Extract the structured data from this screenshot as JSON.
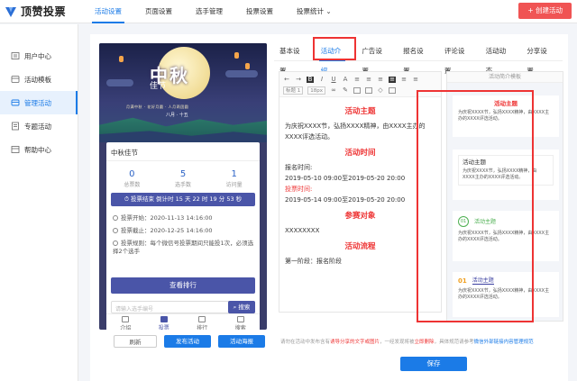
{
  "brand": {
    "name": "顶赞投票",
    "color": "#1b7be7",
    "logo_color": "#2b6fd6"
  },
  "topnav": [
    {
      "label": "活动设置",
      "active": true
    },
    {
      "label": "页面设置",
      "active": false
    },
    {
      "label": "选手管理",
      "active": false
    },
    {
      "label": "投票设置",
      "active": false
    },
    {
      "label": "投票统计",
      "active": false
    }
  ],
  "create_button": "+ 创建活动",
  "sidebar": [
    {
      "label": "用户中心",
      "icon": "user-icon",
      "active": false
    },
    {
      "label": "活动模板",
      "icon": "template-icon",
      "active": false
    },
    {
      "label": "管理活动",
      "icon": "manage-icon",
      "active": true
    },
    {
      "label": "专题活动",
      "icon": "topic-icon",
      "active": false
    },
    {
      "label": "帮助中心",
      "icon": "help-icon",
      "active": false
    }
  ],
  "preview": {
    "poster": {
      "title": "中秋",
      "subtitle": "佳节",
      "tagline": "月满中秋 · 花好月圆 · 人月两团圆",
      "date_text": "八月 · 十五"
    },
    "card_title": "中秋佳节",
    "stats": [
      {
        "num": "0",
        "label": "总票数"
      },
      {
        "num": "5",
        "label": "选手数"
      },
      {
        "num": "1",
        "label": "访问量"
      }
    ],
    "countdown": "投票结束 倒计时 15 天 22 时 19 分 53 秒",
    "vote_start": "投票开始：2020-11-13 14:16:00",
    "vote_end": "投票截止：2020-12-25 14:16:00",
    "vote_rule": "投票规则：每个微信号投票期间只能投1次，必须选择2个选手",
    "rank_button": "查看排行",
    "search_placeholder": "请输入选手编号",
    "search_button": "搜索",
    "tabs": [
      {
        "label": "介绍",
        "active": false
      },
      {
        "label": "投票",
        "active": true
      },
      {
        "label": "排行",
        "active": false
      },
      {
        "label": "搜索",
        "active": false
      }
    ],
    "actions": {
      "refresh": "刷新",
      "publish": "发布活动",
      "poster": "活动海报"
    }
  },
  "settings_tabs": [
    {
      "label": "基本设置",
      "active": false
    },
    {
      "label": "活动介绍",
      "active": true
    },
    {
      "label": "广告设置",
      "active": false
    },
    {
      "label": "报名设置",
      "active": false
    },
    {
      "label": "评论设置",
      "active": false
    },
    {
      "label": "活动动态",
      "active": false
    },
    {
      "label": "分享设置",
      "active": false
    }
  ],
  "editor": {
    "heading_select": "标题 1",
    "font_size_select": "18px",
    "content": [
      {
        "type": "h",
        "text": "活动主题"
      },
      {
        "type": "p",
        "text": "为庆祝XXXX节，弘扬XXXX精神，由XXXX主办的XXXX评选活动。"
      },
      {
        "type": "h",
        "text": "活动时间"
      },
      {
        "type": "p",
        "text": "报名时间:"
      },
      {
        "type": "p",
        "text": "2019-05-10 09:00至2019-05-20 20:00"
      },
      {
        "type": "pr",
        "text": "投票时间:"
      },
      {
        "type": "p",
        "text": "2019-05-14 09:00至2019-05-20 20:00"
      },
      {
        "type": "h",
        "text": "参赛对象"
      },
      {
        "type": "p",
        "text": "XXXXXXXX"
      },
      {
        "type": "h",
        "text": "活动流程"
      },
      {
        "type": "p",
        "text": "第一阶段：报名阶段"
      }
    ]
  },
  "template_panel": {
    "header": "活动简介模板",
    "templates": [
      {
        "title": "活动主题",
        "body": "为庆祝XXXX节，弘扬XXXX精神，由XXXX主办的XXXX评选活动。"
      },
      {
        "title": "活动主题",
        "body": "为庆祝XXXX节，弘扬XXXX精神，由XXXX主办的XXXX评选活动。"
      },
      {
        "title": "活动主题",
        "num": "01",
        "body": "为庆祝XXXX节，弘扬XXXX精神，由XXXX主办的XXXX评选活动。"
      },
      {
        "title": "活动主题",
        "num": "01",
        "body": "为庆祝XXXX节，弘扬XXXX精神，由XXXX主办的XXXX评选活动。"
      }
    ]
  },
  "notice": {
    "prefix": "请勿在活动中发布含有",
    "red1": "诱导分享的文字或图片",
    "mid": "，一经发现将被",
    "red2": "立即删除",
    "suffix": "，具体规范请参考",
    "link": "微信外部链接内容管理规范"
  },
  "save_button": "保存"
}
